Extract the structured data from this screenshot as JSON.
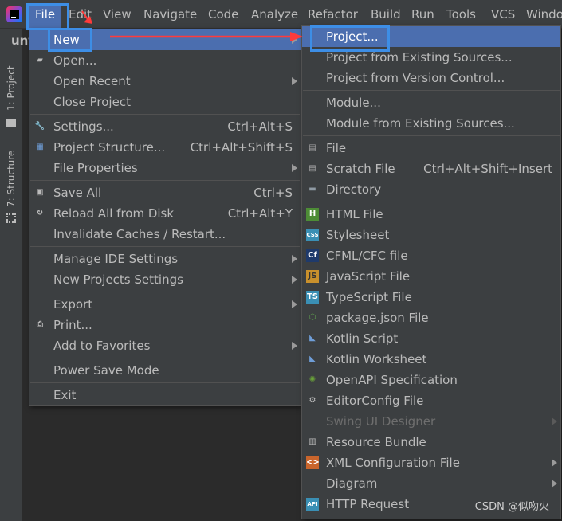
{
  "menubar": {
    "items": [
      "File",
      "Edit",
      "View",
      "Navigate",
      "Code",
      "Analyze",
      "Refactor",
      "Build",
      "Run",
      "Tools",
      "VCS",
      "Windo"
    ],
    "active": "File"
  },
  "sidebar": {
    "project_tab": "1: Project",
    "structure_tab": "7: Structure",
    "project_name": "unt"
  },
  "file_menu": [
    {
      "label": "New",
      "selected": true,
      "submenu": true
    },
    {
      "label": "Open...",
      "icon": "folder-icon"
    },
    {
      "label": "Open Recent",
      "submenu": true
    },
    {
      "label": "Close Project"
    },
    {
      "sep": true
    },
    {
      "label": "Settings...",
      "shortcut": "Ctrl+Alt+S",
      "icon": "wrench-icon"
    },
    {
      "label": "Project Structure...",
      "shortcut": "Ctrl+Alt+Shift+S",
      "icon": "project-structure-icon"
    },
    {
      "label": "File Properties",
      "submenu": true
    },
    {
      "sep": true
    },
    {
      "label": "Save All",
      "shortcut": "Ctrl+S",
      "icon": "save-icon"
    },
    {
      "label": "Reload All from Disk",
      "shortcut": "Ctrl+Alt+Y",
      "icon": "reload-icon"
    },
    {
      "label": "Invalidate Caches / Restart..."
    },
    {
      "sep": true
    },
    {
      "label": "Manage IDE Settings",
      "submenu": true
    },
    {
      "label": "New Projects Settings",
      "submenu": true
    },
    {
      "sep": true
    },
    {
      "label": "Export",
      "submenu": true
    },
    {
      "label": "Print...",
      "icon": "print-icon"
    },
    {
      "label": "Add to Favorites",
      "submenu": true
    },
    {
      "sep": true
    },
    {
      "label": "Power Save Mode"
    },
    {
      "sep": true
    },
    {
      "label": "Exit"
    }
  ],
  "new_submenu": [
    {
      "label": "Project...",
      "selected": true
    },
    {
      "label": "Project from Existing Sources..."
    },
    {
      "label": "Project from Version Control..."
    },
    {
      "sep": true
    },
    {
      "label": "Module..."
    },
    {
      "label": "Module from Existing Sources..."
    },
    {
      "sep": true
    },
    {
      "label": "File",
      "icon": "file-icon"
    },
    {
      "label": "Scratch File",
      "shortcut": "Ctrl+Alt+Shift+Insert",
      "icon": "scratch-file-icon"
    },
    {
      "label": "Directory",
      "icon": "directory-icon"
    },
    {
      "sep": true
    },
    {
      "label": "HTML File",
      "icon": "html-file-icon"
    },
    {
      "label": "Stylesheet",
      "icon": "css-file-icon"
    },
    {
      "label": "CFML/CFC file",
      "icon": "cfml-icon"
    },
    {
      "label": "JavaScript File",
      "icon": "js-file-icon"
    },
    {
      "label": "TypeScript File",
      "icon": "ts-file-icon"
    },
    {
      "label": "package.json File",
      "icon": "nodejs-icon"
    },
    {
      "label": "Kotlin Script",
      "icon": "kotlin-icon"
    },
    {
      "label": "Kotlin Worksheet",
      "icon": "kotlin-icon"
    },
    {
      "label": "OpenAPI Specification",
      "icon": "openapi-icon"
    },
    {
      "label": "EditorConfig File",
      "icon": "editorconfig-icon"
    },
    {
      "label": "Swing UI Designer",
      "disabled": true,
      "submenu": true
    },
    {
      "label": "Resource Bundle",
      "icon": "resource-bundle-icon"
    },
    {
      "label": "XML Configuration File",
      "icon": "xml-icon",
      "submenu": true
    },
    {
      "label": "Diagram",
      "submenu": true
    },
    {
      "label": "HTTP Request",
      "icon": "api-icon"
    }
  ],
  "colors": {
    "selection": "#4b6eaf",
    "annotation_box": "#3d8ee6",
    "annotation_arrow": "#ff3b3b"
  },
  "watermark": "CSDN @似吻火"
}
